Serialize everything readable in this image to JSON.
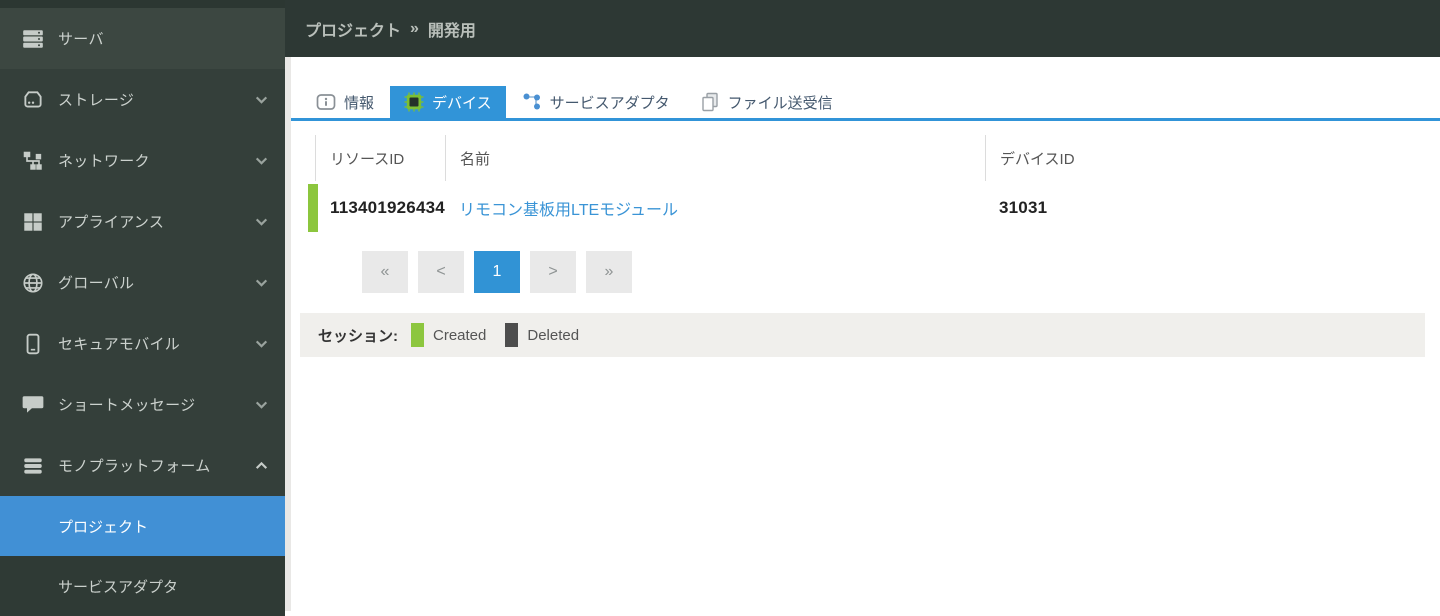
{
  "sidebar": {
    "items": [
      {
        "label": "サーバ",
        "icon": "server-icon",
        "chevron": "none"
      },
      {
        "label": "ストレージ",
        "icon": "storage-icon",
        "chevron": "down"
      },
      {
        "label": "ネットワーク",
        "icon": "network-icon",
        "chevron": "down"
      },
      {
        "label": "アプライアンス",
        "icon": "appliance-icon",
        "chevron": "down"
      },
      {
        "label": "グローバル",
        "icon": "globe-icon",
        "chevron": "down"
      },
      {
        "label": "セキュアモバイル",
        "icon": "mobile-icon",
        "chevron": "down"
      },
      {
        "label": "ショートメッセージ",
        "icon": "message-icon",
        "chevron": "down"
      },
      {
        "label": "モノプラットフォーム",
        "icon": "platform-icon",
        "chevron": "up"
      }
    ],
    "submenu": [
      {
        "label": "プロジェクト",
        "selected": true
      },
      {
        "label": "サービスアダプタ",
        "selected": false
      }
    ]
  },
  "header": {
    "breadcrumb": {
      "section": "プロジェクト",
      "separator": "»",
      "current": "開発用"
    }
  },
  "tabs": [
    {
      "label": "情報",
      "icon": "info-icon",
      "active": false
    },
    {
      "label": "デバイス",
      "icon": "chip-icon",
      "active": true
    },
    {
      "label": "サービスアダプタ",
      "icon": "adapter-icon",
      "active": false
    },
    {
      "label": "ファイル送受信",
      "icon": "files-icon",
      "active": false
    }
  ],
  "table": {
    "columns": [
      "リソースID",
      "名前",
      "デバイスID"
    ],
    "rows": [
      {
        "resource_id": "113401926434",
        "name": "リモコン基板用LTEモジュール",
        "device_id": "31031",
        "session_status": "Created"
      }
    ]
  },
  "pagination": {
    "first": "«",
    "prev": "<",
    "pages": [
      "1"
    ],
    "current_page": "1",
    "next": ">",
    "last": "»"
  },
  "legend": {
    "label": "セッション:",
    "items": [
      {
        "label": "Created",
        "color": "#8cc63e"
      },
      {
        "label": "Deleted",
        "color": "#4d4d4d"
      }
    ]
  },
  "colors": {
    "sidebar_background": "#343f3a",
    "submenu_background": "#2f3a35",
    "header_background": "#2d3834",
    "sidebar_selected_blue": "#4190d5",
    "tab_active_blue": "#3194d8",
    "pagination_active_blue": "#3193d5",
    "link_blue": "#3a94d6",
    "session_created_green": "#8cc63e",
    "session_deleted_gray": "#4d4d4d"
  }
}
